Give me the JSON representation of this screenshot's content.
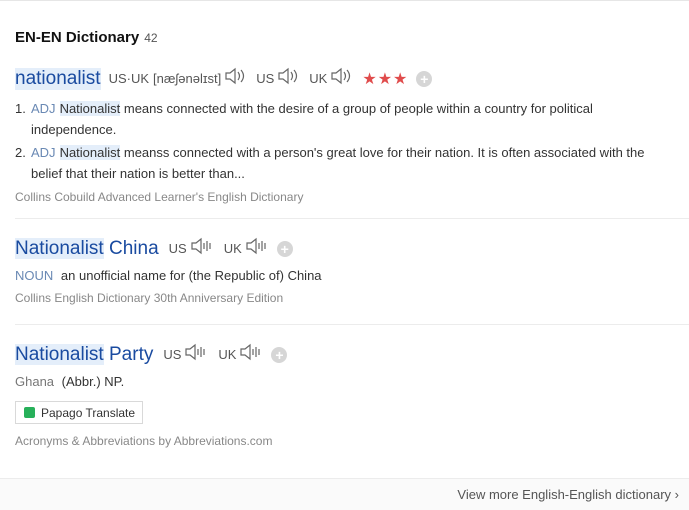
{
  "header": {
    "title": "EN-EN Dictionary",
    "count": "42"
  },
  "entry1": {
    "word": "nationalist",
    "pron_label": "US·UK",
    "ipa": "[næʃənəlɪst]",
    "us_label": "US",
    "uk_label": "UK",
    "stars": "★★★",
    "definitions": [
      {
        "num": "1.",
        "pos": "ADJ",
        "hl": "Nationalist",
        "text": " means connected with the desire of a group of people within a country for political",
        "text2": "independence."
      },
      {
        "num": "2.",
        "pos": "ADJ",
        "hl": "Nationalist",
        "text": " meanss connected with a person's great love for their nation. It is often associated with the",
        "text2": "belief that their nation is better than..."
      }
    ],
    "source": "Collins Cobuild Advanced Learner's English Dictionary"
  },
  "entry2": {
    "word_hl": "Nationalist",
    "word_rest": " China",
    "us_label": "US",
    "uk_label": "UK",
    "pos": "NOUN",
    "text": "an unofficial name for (the Republic of) China",
    "source": "Collins English Dictionary 30th Anniversary Edition"
  },
  "entry3": {
    "word_hl": "Nationalist",
    "word_rest": " Party",
    "us_label": "US",
    "uk_label": "UK",
    "country": "Ghana",
    "text": "(Abbr.) NP.",
    "papago": "Papago Translate",
    "source": "Acronyms & Abbreviations by Abbreviations.com"
  },
  "footer": {
    "more": "View more English-English dictionary"
  }
}
